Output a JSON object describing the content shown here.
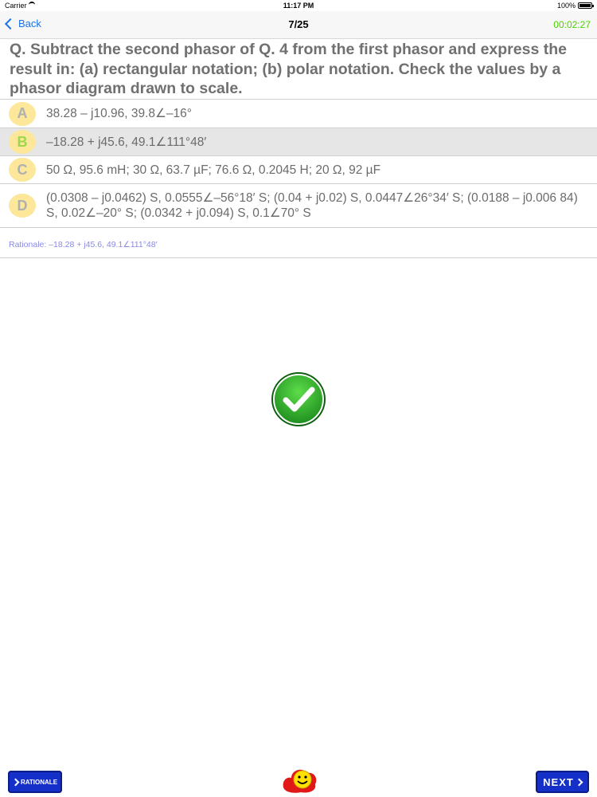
{
  "status": {
    "carrier": "Carrier",
    "time": "11:17 PM",
    "battery": "100%"
  },
  "nav": {
    "back_label": "Back",
    "progress": "7/25",
    "timer": "00:02:27"
  },
  "question": "Q. Subtract the second phasor of Q. 4 from the first phasor and express the result in: (a) rectangular notation; (b) polar notation. Check the values by a phasor diagram drawn to scale.",
  "options": [
    {
      "letter": "A",
      "text": "38.28 – j10.96, 39.8∠–16°"
    },
    {
      "letter": "B",
      "text": "–18.28 + j45.6, 49.1∠111°48′"
    },
    {
      "letter": "C",
      "text": "50 Ω, 95.6 mH; 30 Ω, 63.7 µF; 76.6 Ω, 0.2045 H; 20 Ω, 92 µF"
    },
    {
      "letter": "D",
      "text": "(0.0308 – j0.0462) S, 0.0555∠–56°18′ S; (0.04 + j0.02) S, 0.0447∠26°34′ S; (0.0188 – j0.006 84) S, 0.02∠–20° S; (0.0342 + j0.094) S, 0.1∠70° S"
    }
  ],
  "selected_option": "B",
  "rationale": "Rationale: –18.28 + j45.6, 49.1∠111°48′",
  "buttons": {
    "rationale": "RATIONALE",
    "next": "NEXT"
  },
  "colors": {
    "accent": "#1a73e8",
    "timer": "#4cd000",
    "badge": "#fce79a",
    "button": "#1430c8",
    "check": "#2aa52a"
  },
  "icons": [
    "back-chevron-icon",
    "check-mark-icon",
    "smiley-icon",
    "chevron-right-icon"
  ]
}
